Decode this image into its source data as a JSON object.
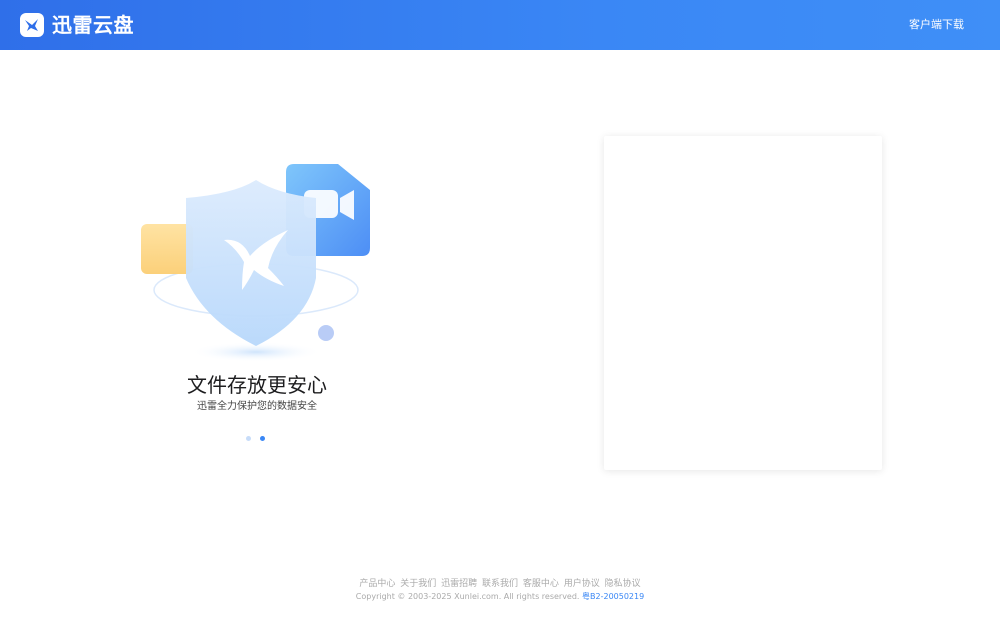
{
  "header": {
    "logo_text": "迅雷云盘",
    "download_label": "客户端下载"
  },
  "hero": {
    "title": "文件存放更安心",
    "subtitle": "迅雷全力保护您的数据安全",
    "carousel": {
      "count": 2,
      "active_index": 1
    }
  },
  "footer": {
    "links": [
      "产品中心",
      "关于我们",
      "迅雷招聘",
      "联系我们",
      "客服中心",
      "用户协议",
      "隐私协议"
    ],
    "copyright": "Copyright © 2003-2025 Xunlei.com. All rights reserved.",
    "icp": "粤B2-20050219"
  },
  "colors": {
    "header_blue": "#3a87f5",
    "link_blue": "#3a87f5"
  }
}
